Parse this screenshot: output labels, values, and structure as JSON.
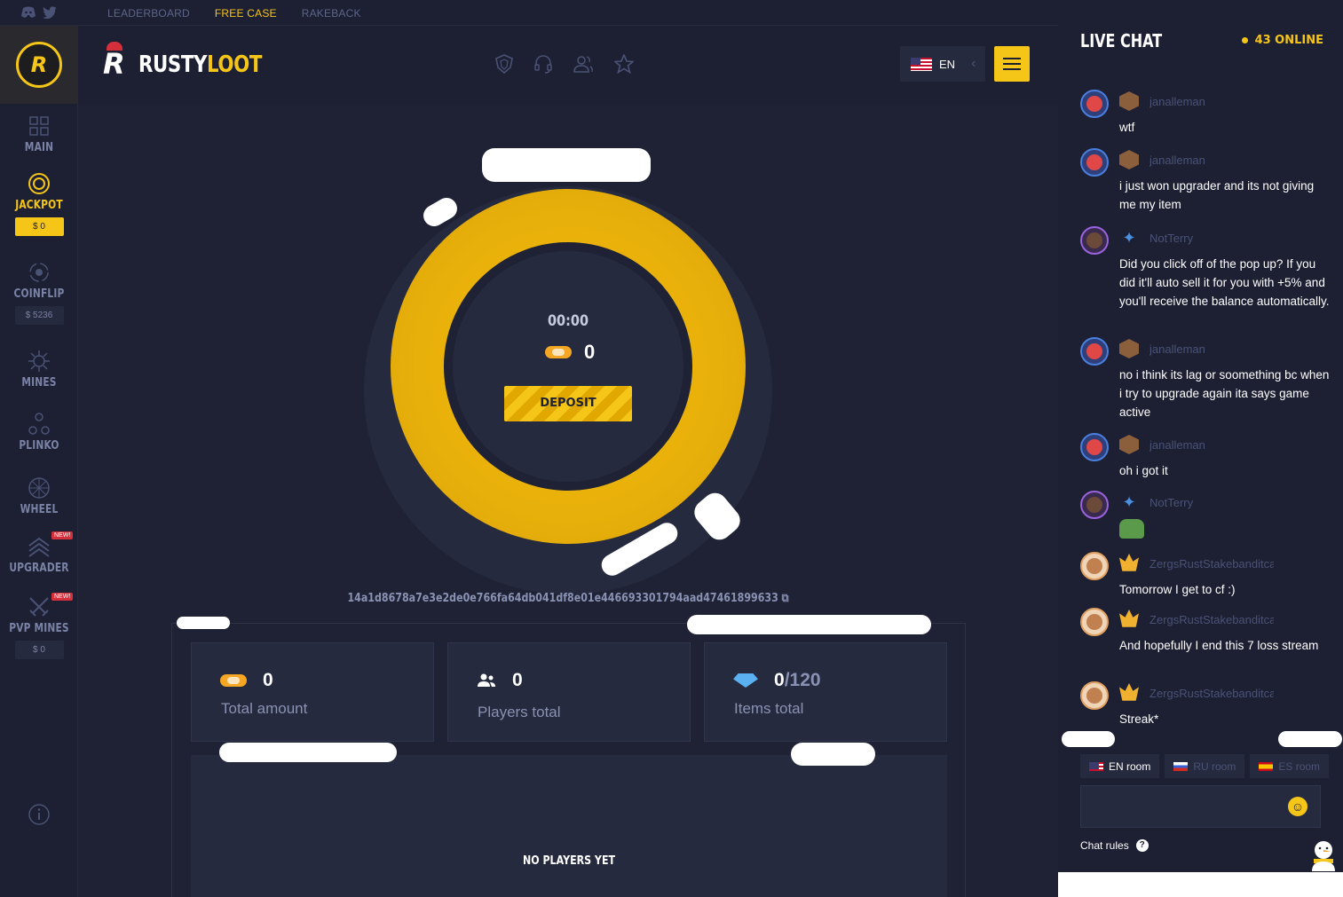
{
  "topbar": {
    "social": [
      "discord-icon",
      "twitter-icon"
    ],
    "links": [
      {
        "label": "LEADERBOARD",
        "active": false
      },
      {
        "label": "FREE CASE",
        "active": true
      },
      {
        "label": "RAKEBACK",
        "active": false
      }
    ]
  },
  "sidebar": {
    "items": [
      {
        "label": "MAIN",
        "icon": "grid-icon"
      },
      {
        "label": "JACKPOT",
        "icon": "target-icon",
        "badge": "$ 0",
        "active": true
      },
      {
        "label": "COINFLIP",
        "icon": "coinflip-icon",
        "badge": "$ 5236"
      },
      {
        "label": "MINES",
        "icon": "mine-icon"
      },
      {
        "label": "PLINKO",
        "icon": "plinko-icon"
      },
      {
        "label": "WHEEL",
        "icon": "wheel-icon"
      },
      {
        "label": "UPGRADER",
        "icon": "upgrader-icon",
        "tag": "NEW!"
      },
      {
        "label": "PVP MINES",
        "icon": "swords-icon",
        "tag": "NEW!",
        "badge": "$ 0"
      }
    ],
    "info_icon": "info-icon"
  },
  "header": {
    "brand_white": "RUSTY",
    "brand_yellow": "LOOT",
    "icons": [
      "shield-icon",
      "headset-icon",
      "users-icon",
      "star-icon"
    ],
    "language": "EN"
  },
  "jackpot": {
    "timer": "00:00",
    "pot_value": "0",
    "deposit_label": "DEPOSIT",
    "hash": "14a1d8678a7e3e2de0e766fa64db041df8e01e446693301794aad47461899633"
  },
  "stats": {
    "total_amount": {
      "value": "0",
      "label": "Total amount"
    },
    "players_total": {
      "value": "0",
      "label": "Players total"
    },
    "items_total": {
      "value": "0",
      "max": "/120",
      "label": "Items total"
    }
  },
  "players": {
    "empty_text": "NO PLAYERS YET"
  },
  "chat": {
    "title": "LIVE CHAT",
    "online": "43 ONLINE",
    "messages": [
      {
        "user": "janalleman",
        "text": "wtf"
      },
      {
        "user": "janalleman",
        "text": "i just won upgrader and its not giving me my item"
      },
      {
        "user": "NotTerry",
        "text": "Did you click off of the pop up? If you did it'll auto sell it for you with +5% and you'll receive the balance automatically."
      },
      {
        "user": "janalleman",
        "text": "no i think its lag or soomething bc when i try to upgrade again ita says game active"
      },
      {
        "user": "janalleman",
        "text": "oh i got it"
      },
      {
        "user": "NotTerry",
        "text": ""
      },
      {
        "user": "ZergsRustStakebanditca",
        "text": "Tomorrow I get to cf :)"
      },
      {
        "user": "ZergsRustStakebanditca",
        "text": "And hopefully I end this 7 loss stream"
      },
      {
        "user": "ZergsRustStakebanditca",
        "text": "Streak*"
      }
    ],
    "rooms": [
      {
        "label": "EN room",
        "active": true
      },
      {
        "label": "RU room",
        "active": false
      },
      {
        "label": "ES room",
        "active": false
      }
    ],
    "input_value": "",
    "rules_label": "Chat rules"
  },
  "colors": {
    "accent": "#f5c518",
    "background": "#1f2234",
    "panel": "#262a3e"
  }
}
